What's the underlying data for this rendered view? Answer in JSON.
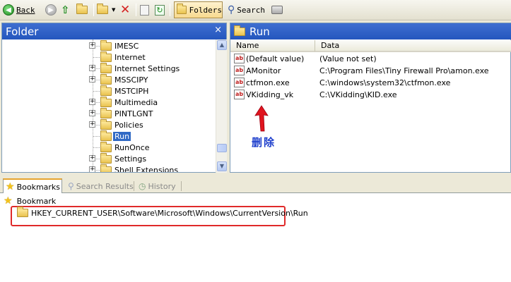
{
  "toolbar": {
    "back_label": "Back",
    "back_key": "B",
    "folders_label": "Folders",
    "search_label": "Search"
  },
  "folder_pane": {
    "title": "Folder",
    "close": "×",
    "items": [
      {
        "label": "IMESC",
        "expandable": true
      },
      {
        "label": "Internet",
        "expandable": false
      },
      {
        "label": "Internet Settings",
        "expandable": true
      },
      {
        "label": "MSSCIPY",
        "expandable": true
      },
      {
        "label": "MSTCIPH",
        "expandable": false
      },
      {
        "label": "Multimedia",
        "expandable": true
      },
      {
        "label": "PINTLGNT",
        "expandable": true
      },
      {
        "label": "Policies",
        "expandable": true
      },
      {
        "label": "Run",
        "expandable": false,
        "selected": true
      },
      {
        "label": "RunOnce",
        "expandable": false
      },
      {
        "label": "Settings",
        "expandable": true
      },
      {
        "label": "Shell Extensions",
        "expandable": true
      }
    ]
  },
  "run_pane": {
    "title": "Run",
    "columns": [
      "Name",
      "Data"
    ],
    "rows": [
      {
        "name": "(Default value)",
        "data": "(Value not set)"
      },
      {
        "name": "AMonitor",
        "data": "C:\\Program Files\\Tiny Firewall Pro\\amon.exe"
      },
      {
        "name": "ctfmon.exe",
        "data": "C:\\windows\\system32\\ctfmon.exe"
      },
      {
        "name": "VKidding_vk",
        "data": "C:\\VKidding\\KID.exe"
      }
    ],
    "icon_text": "ab"
  },
  "annotation": {
    "text": "删除",
    "color": "#1e3fcc",
    "arrow_color": "#e0141e"
  },
  "tabs": [
    {
      "label": "Bookmarks",
      "active": true
    },
    {
      "label": "Search Results",
      "active": false
    },
    {
      "label": "History",
      "active": false
    }
  ],
  "bookmarks": {
    "root_label": "Bookmark",
    "entry": "HKEY_CURRENT_USER\\Software\\Microsoft\\Windows\\CurrentVersion\\Run"
  },
  "colors": {
    "title_bar": "#2456be",
    "selection": "#316ac5",
    "highlight_box": "#e02a2a"
  }
}
